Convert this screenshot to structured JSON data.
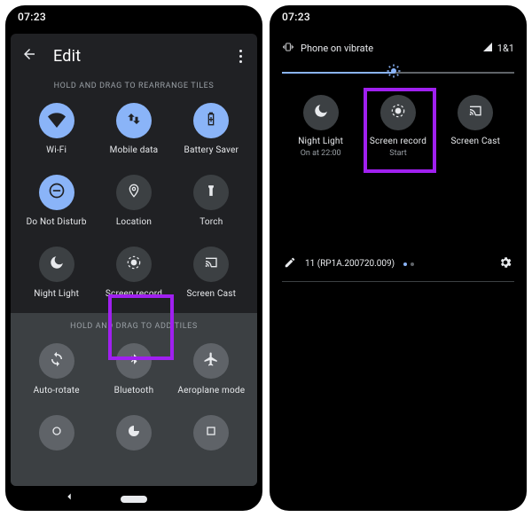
{
  "left": {
    "clock": "07:23",
    "title": "Edit",
    "caption_rearrange": "HOLD AND DRAG TO REARRANGE TILES",
    "caption_add": "HOLD AND DRAG TO ADD TILES",
    "tiles": {
      "wifi": "Wi-Fi",
      "mobile_data": "Mobile data",
      "battery_saver": "Battery Saver",
      "dnd": "Do Not Disturb",
      "location": "Location",
      "torch": "Torch",
      "night_light": "Night Light",
      "screen_record": "Screen record",
      "screen_cast": "Screen Cast",
      "auto_rotate": "Auto-rotate",
      "bluetooth": "Bluetooth",
      "aeroplane": "Aeroplane mode"
    }
  },
  "right": {
    "clock": "07:23",
    "vibrate_text": "Phone on vibrate",
    "sim_text": "1&1",
    "tiles": {
      "night_light": {
        "label": "Night Light",
        "sub": "On at 22:00"
      },
      "screen_record": {
        "label": "Screen record",
        "sub": "Start"
      },
      "screen_cast": {
        "label": "Screen Cast",
        "sub": ""
      }
    },
    "build_text": "11 (RP1A.200720.009)"
  },
  "colors": {
    "accent": "#8ab4f8",
    "highlight": "#a020f0",
    "inactive_tile": "#3c4043",
    "panel_bg": "#202124"
  }
}
